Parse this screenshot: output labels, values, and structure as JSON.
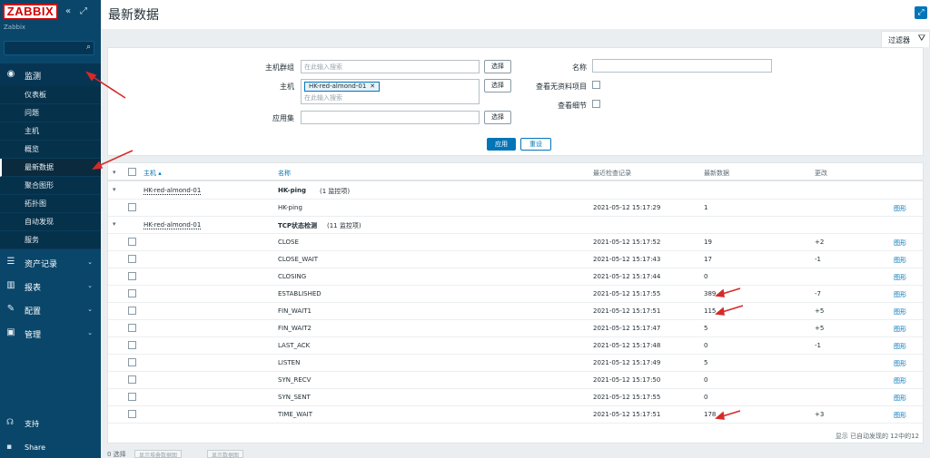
{
  "sidebar": {
    "logo": "ZABBIX",
    "server_name": "Zabbix",
    "search_placeholder": "",
    "sections": [
      {
        "label": "监测",
        "icon": "eye-icon",
        "active": true
      },
      {
        "label": "资产记录",
        "icon": "list-icon"
      },
      {
        "label": "报表",
        "icon": "bar-chart-icon"
      },
      {
        "label": "配置",
        "icon": "wrench-icon"
      },
      {
        "label": "管理",
        "icon": "gear-icon"
      }
    ],
    "monitoring_items": [
      "仪表板",
      "问题",
      "主机",
      "概览",
      "最新数据",
      "聚合图形",
      "拓扑图",
      "自动发现",
      "服务"
    ],
    "support_label": "支持",
    "share_label": "Share"
  },
  "header": {
    "title": "最新数据"
  },
  "filter": {
    "tab_label": "过滤器",
    "host_group_label": "主机群组",
    "host_group_placeholder": "在此输入搜索",
    "host_label": "主机",
    "host_chip": "HK-red-almond-01",
    "host_placeholder": "在此输入搜索",
    "app_label": "应用集",
    "select_label": "选择",
    "name_label": "名称",
    "show_no_data_label": "查看无资料项目",
    "show_details_label": "查看细节",
    "apply_label": "应用",
    "reset_label": "重设"
  },
  "table": {
    "columns": {
      "host": "主机 ▴",
      "name": "名称",
      "last_check": "最近检查记录",
      "last_value": "最新数据",
      "change": "更改"
    },
    "groups": [
      {
        "host": "HK-red-almond-01",
        "app": "HK-ping",
        "count": "(1 监控项)",
        "items": [
          {
            "name": "HK-ping",
            "time": "2021-05-12 15:17:29",
            "value": "1",
            "change": "",
            "graph": "图形"
          }
        ]
      },
      {
        "host": "HK-red-almond-01",
        "app": "TCP状态检测",
        "count": "(11 监控项)",
        "items": [
          {
            "name": "CLOSE",
            "time": "2021-05-12 15:17:52",
            "value": "19",
            "change": "+2",
            "graph": "图形"
          },
          {
            "name": "CLOSE_WAIT",
            "time": "2021-05-12 15:17:43",
            "value": "17",
            "change": "-1",
            "graph": "图形"
          },
          {
            "name": "CLOSING",
            "time": "2021-05-12 15:17:44",
            "value": "0",
            "change": "",
            "graph": "图形"
          },
          {
            "name": "ESTABLISHED",
            "time": "2021-05-12 15:17:55",
            "value": "389",
            "change": "-7",
            "graph": "图形"
          },
          {
            "name": "FIN_WAIT1",
            "time": "2021-05-12 15:17:51",
            "value": "115",
            "change": "+5",
            "graph": "图形"
          },
          {
            "name": "FIN_WAIT2",
            "time": "2021-05-12 15:17:47",
            "value": "5",
            "change": "+5",
            "graph": "图形"
          },
          {
            "name": "LAST_ACK",
            "time": "2021-05-12 15:17:48",
            "value": "0",
            "change": "-1",
            "graph": "图形"
          },
          {
            "name": "LISTEN",
            "time": "2021-05-12 15:17:49",
            "value": "5",
            "change": "",
            "graph": "图形"
          },
          {
            "name": "SYN_RECV",
            "time": "2021-05-12 15:17:50",
            "value": "0",
            "change": "",
            "graph": "图形"
          },
          {
            "name": "SYN_SENT",
            "time": "2021-05-12 15:17:55",
            "value": "0",
            "change": "",
            "graph": "图形"
          },
          {
            "name": "TIME_WAIT",
            "time": "2021-05-12 15:17:51",
            "value": "178",
            "change": "+3",
            "graph": "图形"
          }
        ]
      }
    ],
    "footer": "显示 已自动发现的 12中的12"
  },
  "bottom": {
    "select_label": "0 选择",
    "btn1": "显示堆叠数据图",
    "btn2": "显示数据图"
  },
  "colors": {
    "sidebar": "#0a466a",
    "accent": "#0275b8",
    "annotation_arrow": "#d62a2a"
  }
}
